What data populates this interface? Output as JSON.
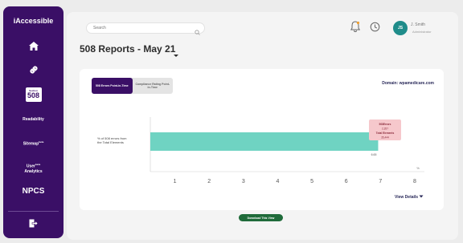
{
  "sidebar": {
    "brand": "iAccessible",
    "items": [
      {
        "icon": "home-icon"
      },
      {
        "icon": "link-icon"
      },
      {
        "badge_small": "Section",
        "badge_big": "508"
      },
      {
        "label": "Readability"
      },
      {
        "label": "Sitemap",
        "tag": "beta"
      },
      {
        "label": "User",
        "label2": "Analytics",
        "tag": "beta"
      },
      {
        "label": "NPCS"
      },
      {
        "icon": "logout-icon"
      }
    ]
  },
  "header": {
    "search_placeholder": "Search",
    "avatar_initials": "JS",
    "user_name": "J. Smith",
    "user_sub": "Administrator"
  },
  "page": {
    "title": "508 Reports - May 21"
  },
  "card": {
    "toggle": [
      {
        "label": "508 Errors Point-in-Time",
        "active": true
      },
      {
        "label": "Compliance Rating Point-in-Time",
        "active": false
      }
    ],
    "domain": "Domain: wpamedicare.com",
    "view_details": "View Details"
  },
  "chart_data": {
    "type": "bar",
    "orientation": "horizontal",
    "categories": [
      "% of 508 errors from the Total Elements"
    ],
    "values": [
      6.65
    ],
    "value_label": "6.65",
    "xlim": [
      0,
      8
    ],
    "xticks": [
      "1",
      "2",
      "3",
      "4",
      "5",
      "6",
      "7",
      "8"
    ],
    "x_unit": "%",
    "tooltip": {
      "line1": "508Errors",
      "line2": "2,357",
      "line3": "Total Elements",
      "line4": "35,444"
    }
  },
  "footer": {
    "download_label": "Download This View"
  },
  "colors": {
    "sidebar": "#3a0f66",
    "bar": "#6fd3c2",
    "accent_green": "#1f6b3a",
    "avatar": "#1f8c8a"
  }
}
